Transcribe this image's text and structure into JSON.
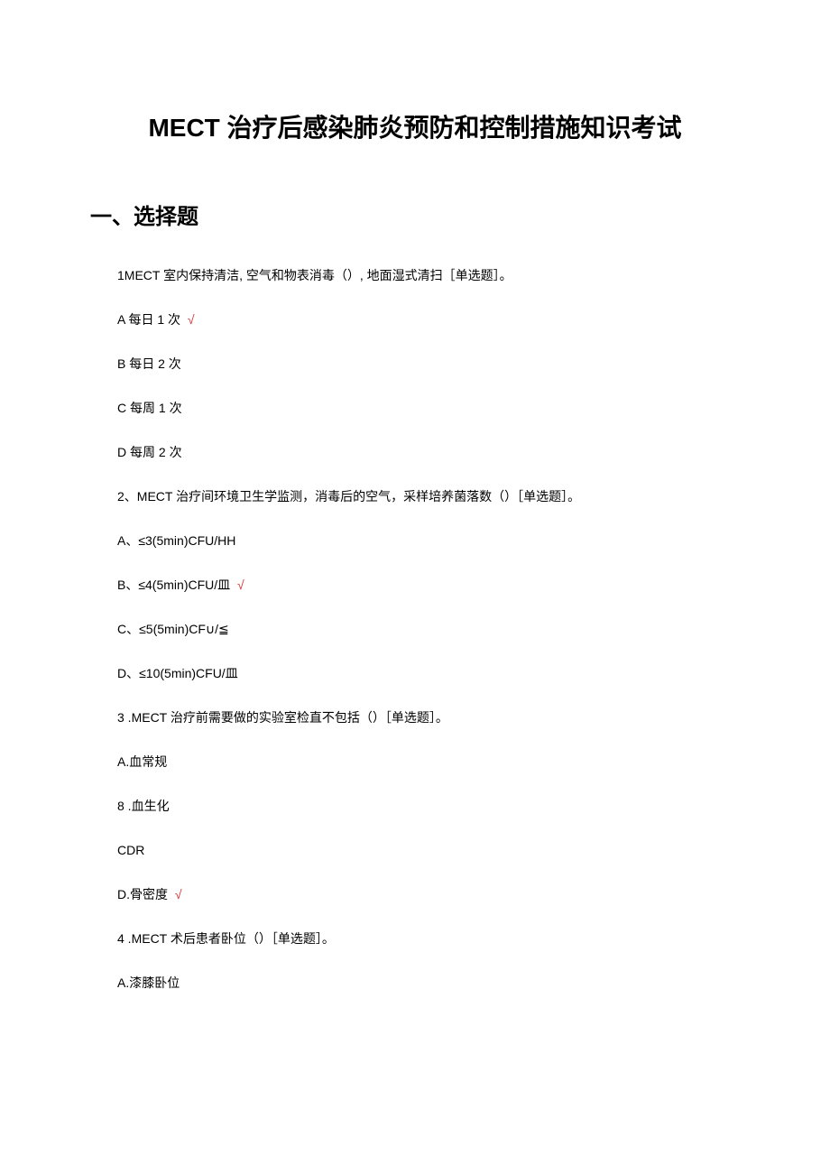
{
  "title": "MECT 治疗后感染肺炎预防和控制措施知识考试",
  "section_heading": "一、选择题",
  "correct_mark": "√",
  "questions": [
    {
      "text": "1MECT 室内保持清洁, 空气和物表消毒（）, 地面湿式清扫［单选题］。",
      "options": [
        {
          "text": "A 每日 1 次",
          "correct": true
        },
        {
          "text": "B 每日 2 次",
          "correct": false
        },
        {
          "text": "C 每周 1 次",
          "correct": false
        },
        {
          "text": "D 每周 2 次",
          "correct": false
        }
      ]
    },
    {
      "text": "2、MECT 治疗间环境卫生学监测，消毒后的空气，采样培养菌落数（）［单选题］。",
      "options": [
        {
          "text": "A、≤3(5min)CFU/HH",
          "correct": false
        },
        {
          "text": "B、≤4(5min)CFU/皿",
          "correct": true
        },
        {
          "text": "C、≤5(5min)CF∪/≦",
          "correct": false
        },
        {
          "text": "D、≤10(5min)CFU/皿",
          "correct": false
        }
      ]
    },
    {
      "text": "3 .MECT 治疗前需要做的实验室检直不包括（）［单选题］。",
      "options": [
        {
          "text": "A.血常规",
          "correct": false
        },
        {
          "text": "8 .血生化",
          "correct": false
        },
        {
          "text": "CDR",
          "correct": false
        },
        {
          "text": "D.骨密度",
          "correct": true
        }
      ]
    },
    {
      "text": "4 .MECT 术后患者卧位（）［单选题］。",
      "options": [
        {
          "text": "A.漆膝卧位",
          "correct": false
        }
      ]
    }
  ]
}
